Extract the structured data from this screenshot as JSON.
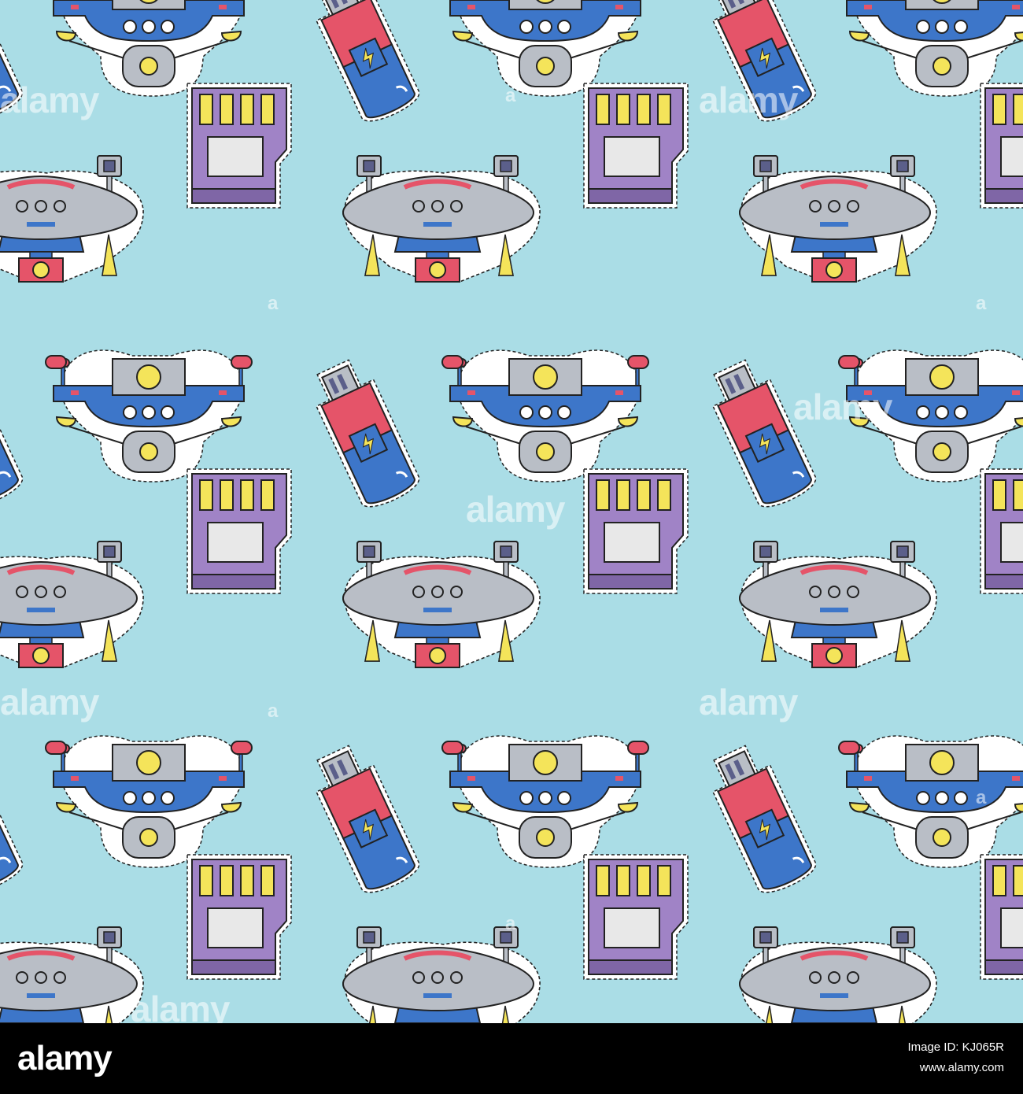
{
  "pattern": {
    "background_color": "#aadde6",
    "stickers": [
      "drone-blue-icon",
      "drone-gray-icon",
      "sd-card-icon",
      "usb-flash-drive-icon"
    ],
    "sticker_colors": {
      "blue": "#3d76c9",
      "gray": "#b9bec6",
      "red": "#e55469",
      "yellow": "#f4e45a",
      "purple": "#a083c6",
      "outline": "#222222"
    }
  },
  "watermark": {
    "text": "alamy",
    "small_text": "a"
  },
  "footer": {
    "logo_text": "alamy",
    "image_id": "Image ID: KJ065R",
    "url": "www.alamy.com"
  }
}
